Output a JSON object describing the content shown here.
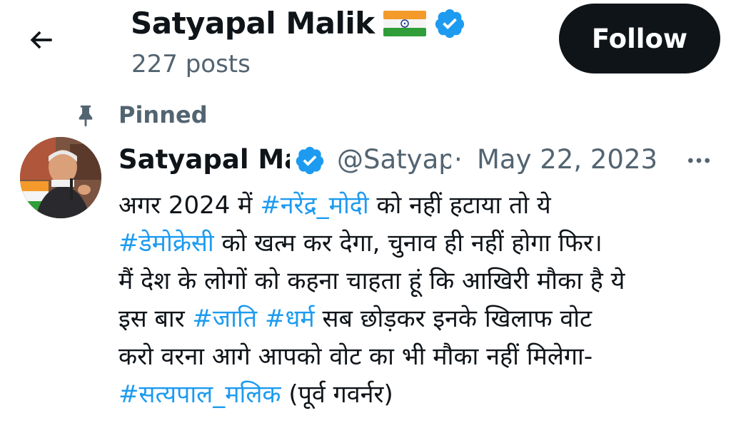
{
  "header": {
    "back_icon": "arrow-left-icon",
    "profile_name": "Satyapal Malik",
    "flag_icon": "india-flag-icon",
    "verified_icon": "verified-badge-icon",
    "post_count": "227 posts",
    "follow_label": "Follow"
  },
  "pinned": {
    "icon": "pin-icon",
    "label": "Pinned"
  },
  "tweet": {
    "author_name": "Satyapal Malik",
    "handle": "@SatyapalMalik",
    "separator": "·",
    "date": "May 22, 2023",
    "more_icon": "more-horizontal-icon",
    "lines": [
      {
        "a": "अगर 2024 में ",
        "tag": "#नरेंद्र_मोदी",
        "b": " को नहीं हटाया तो ये"
      },
      {
        "a": "",
        "tag": "#डेमोक्रेसी",
        "b": " को खत्म कर देगा, चुनाव ही नहीं होगा फिर।"
      },
      {
        "a": "मैं देश के लोगों को कहना चाहता हूं कि आखिरी मौका है ये",
        "tag": "",
        "b": ""
      },
      {
        "a": "इस बार ",
        "tag": "#जाति",
        "mid": " ",
        "tag2": "#धर्म",
        "b": " सब छोड़कर इनके खिलाफ वोट"
      },
      {
        "a": "करो वरना आगे आपको वोट का भी मौका नहीं मिलेगा-",
        "tag": "",
        "b": ""
      },
      {
        "a": "",
        "tag": "#सत्यपाल_मलिक",
        "b": " (पूर्व गवर्नर)"
      }
    ]
  },
  "colors": {
    "link": "#1d9bf0",
    "secondary_text": "#536471",
    "primary_text": "#0f1419",
    "follow_bg": "#0f1419"
  }
}
